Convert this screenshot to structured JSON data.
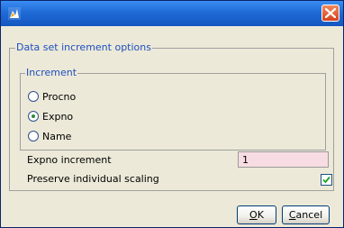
{
  "window": {
    "title": ""
  },
  "options_group": {
    "title": "Data set increment options"
  },
  "increment_group": {
    "title": "Increment",
    "options": [
      {
        "label": "Procno",
        "checked": false
      },
      {
        "label": "Expno",
        "checked": true
      },
      {
        "label": "Name",
        "checked": false
      }
    ]
  },
  "expno_increment": {
    "label": "Expno increment",
    "value": "1"
  },
  "preserve_scaling": {
    "label": "Preserve individual scaling",
    "checked": true
  },
  "buttons": {
    "ok_mnemonic": "O",
    "ok_rest": "K",
    "cancel_mnemonic": "C",
    "cancel_rest": "ancel"
  },
  "colors": {
    "title_bar": "#1f6bd6",
    "accent_text": "#1f4fbf",
    "input_bg": "#f7dde3"
  }
}
